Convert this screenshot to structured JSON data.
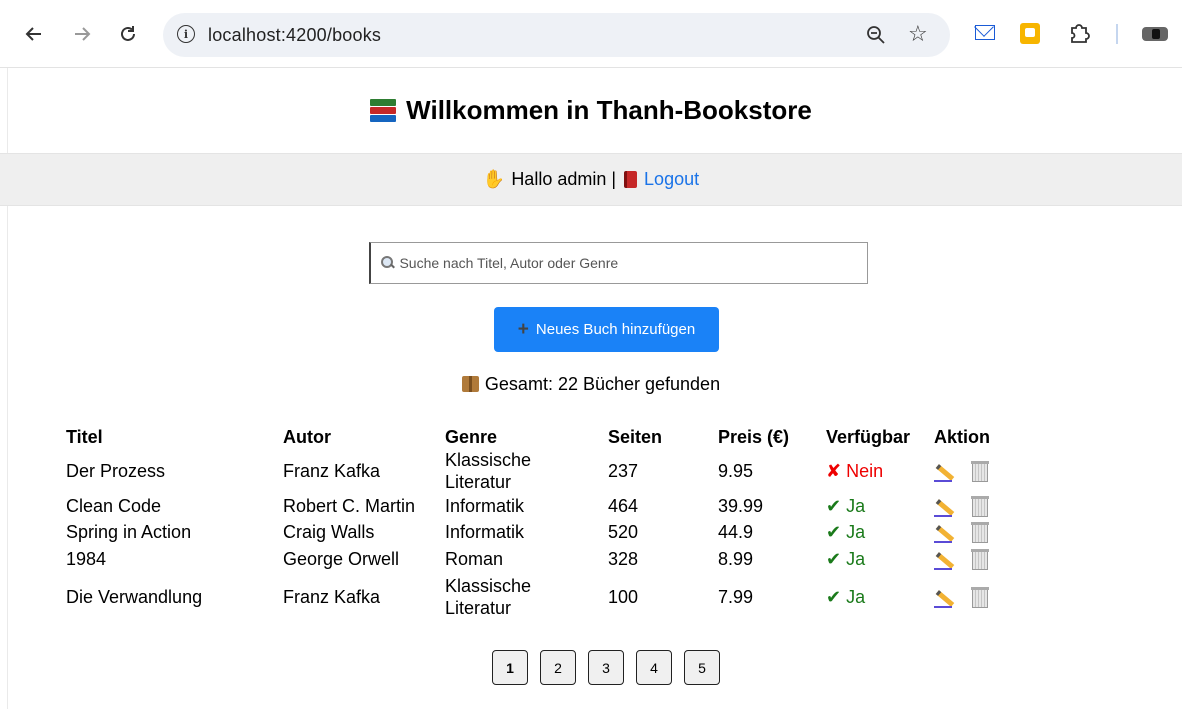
{
  "browser": {
    "url": "localhost:4200/books",
    "icons": [
      "back-arrow-icon",
      "forward-arrow-icon",
      "reload-icon",
      "site-info-icon",
      "zoom-icon",
      "bookmark-star-icon",
      "mail-extension-icon",
      "keep-extension-icon",
      "extensions-puzzle-icon",
      "profile-icon"
    ]
  },
  "header": {
    "title": "Willkommen in Thanh-Bookstore",
    "icon": "books-icon"
  },
  "greeting": {
    "text": "Hallo admin |",
    "logout_label": "Logout",
    "icons": [
      "waving-hand-icon",
      "red-book-icon"
    ]
  },
  "search": {
    "placeholder": "Suche nach Titel, Autor oder Genre",
    "value": ""
  },
  "add_button": {
    "label": "Neues Buch hinzufügen",
    "icon": "plus-icon"
  },
  "summary": {
    "text": "Gesamt: 22 Bücher gefunden",
    "icon": "package-icon"
  },
  "table": {
    "headers": [
      "Titel",
      "Autor",
      "Genre",
      "Seiten",
      "Preis (€)",
      "Verfügbar",
      "Aktion"
    ],
    "rows": [
      {
        "titel": "Der Prozess",
        "autor": "Franz Kafka",
        "genre": "Klassische Literatur",
        "seiten": "237",
        "preis": "9.95",
        "verfuegbar": "✘ Nein",
        "available": false
      },
      {
        "titel": "Clean Code",
        "autor": "Robert C. Martin",
        "genre": "Informatik",
        "seiten": "464",
        "preis": "39.99",
        "verfuegbar": "✔ Ja",
        "available": true
      },
      {
        "titel": "Spring in Action",
        "autor": "Craig Walls",
        "genre": "Informatik",
        "seiten": "520",
        "preis": "44.9",
        "verfuegbar": "✔ Ja",
        "available": true
      },
      {
        "titel": "1984",
        "autor": "George Orwell",
        "genre": "Roman",
        "seiten": "328",
        "preis": "8.99",
        "verfuegbar": "✔ Ja",
        "available": true
      },
      {
        "titel": "Die Verwandlung",
        "autor": "Franz Kafka",
        "genre": "Klassische Literatur",
        "seiten": "100",
        "preis": "7.99",
        "verfuegbar": "✔ Ja",
        "available": true
      }
    ]
  },
  "pagination": {
    "pages": [
      "1",
      "2",
      "3",
      "4",
      "5"
    ],
    "current": "1"
  },
  "colors": {
    "primary_button": "#1a82f7",
    "link": "#1a73e8",
    "available_yes": "#1a7a1a",
    "available_no": "#e00000",
    "greet_bar_bg": "#efefef"
  }
}
